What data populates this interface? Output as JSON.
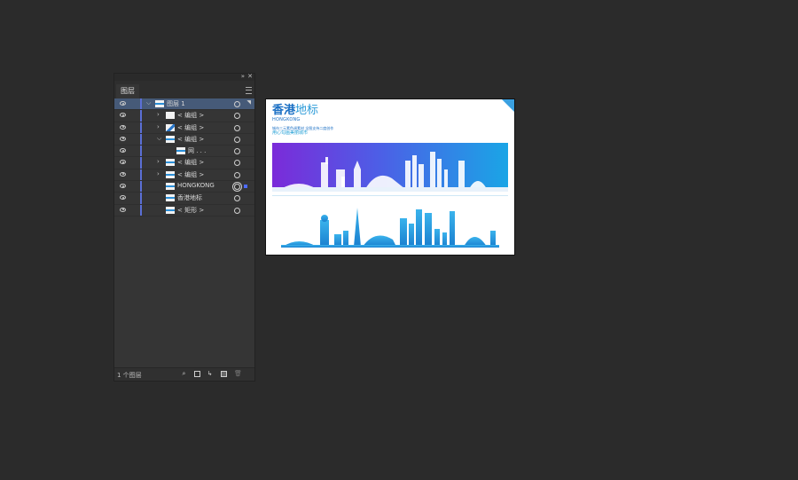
{
  "panel": {
    "collapse_icon": "»",
    "close_icon": "✕",
    "tab_label": "图层",
    "rows": [
      {
        "label": "图层 1",
        "depth": 0,
        "chevron": "⌵",
        "thumb": "blue"
      },
      {
        "label": "< 编组 >",
        "depth": 1,
        "chevron": "›",
        "thumb": "plain"
      },
      {
        "label": "< 编组 >",
        "depth": 1,
        "chevron": "›",
        "thumb": "diag"
      },
      {
        "label": "< 编组 >",
        "depth": 1,
        "chevron": "⌵",
        "thumb": "blue"
      },
      {
        "label": "网 . . .",
        "depth": 2,
        "chevron": "",
        "thumb": "blue"
      },
      {
        "label": "< 编组 >",
        "depth": 1,
        "chevron": "›",
        "thumb": "blue"
      },
      {
        "label": "< 编组 >",
        "depth": 1,
        "chevron": "›",
        "thumb": "blue"
      },
      {
        "label": "HONGKONG",
        "depth": 1,
        "chevron": "",
        "thumb": "blue"
      },
      {
        "label": "香港地标",
        "depth": 1,
        "chevron": "",
        "thumb": "blue"
      },
      {
        "label": "< 矩形 >",
        "depth": 1,
        "chevron": "",
        "thumb": "blue"
      }
    ],
    "footer": {
      "count": "1 个图层"
    }
  },
  "artboard": {
    "title_bold": "香港",
    "title_thin": "地标",
    "title_en": "HONGKONG",
    "subtitle": "城市三元素色调素材  全图支持二度创作",
    "subtitle2": "用心勾画美丽城市",
    "colors": {
      "banner_start": "#7b2bd9",
      "banner_end": "#1aa5e6",
      "skyline": "#1f9ad9",
      "accent": "#1a6fc4"
    }
  }
}
